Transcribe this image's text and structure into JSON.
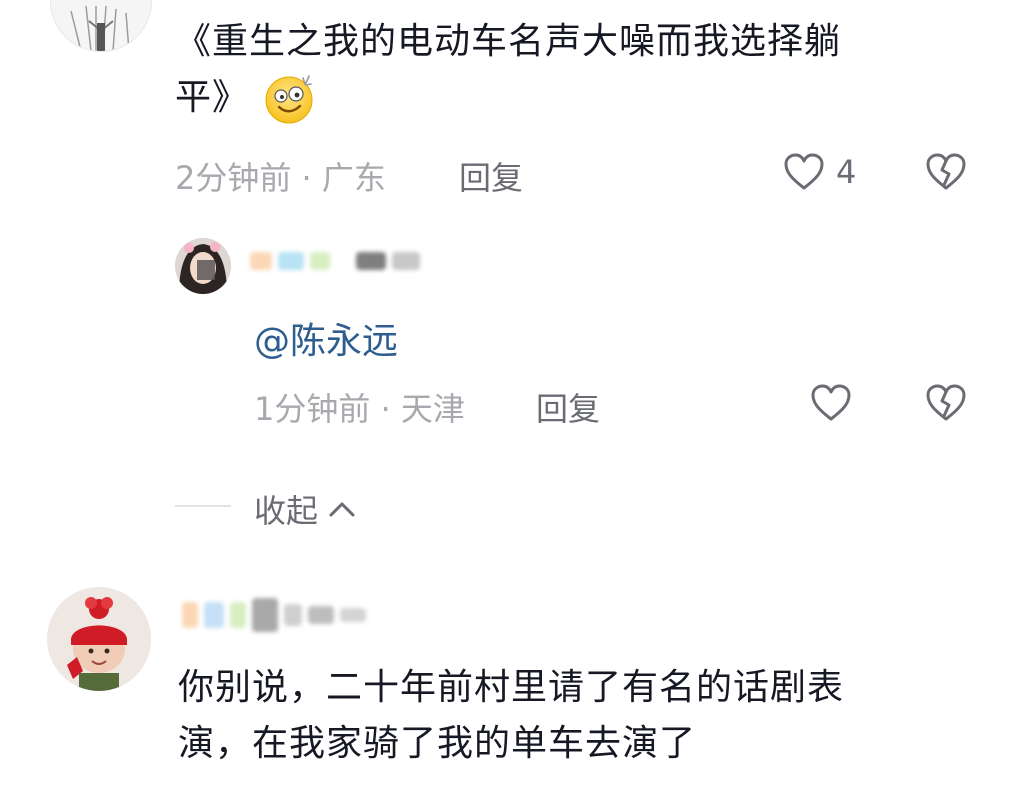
{
  "comment_1": {
    "text_line_1": "《重生之我的电动车名声大噪而我选择躺",
    "text_line_2": "平》",
    "emoji": "dizzy-grin-emoji",
    "time_location": "2分钟前 · 广东",
    "reply_label": "回复",
    "like_count": "4"
  },
  "reply_1": {
    "text": "@陈永远",
    "time_location": "1分钟前 · 天津",
    "reply_label": "回复"
  },
  "collapse": {
    "label": "收起"
  },
  "comment_2": {
    "text_line_1": "你别说，二十年前村里请了有名的话剧表",
    "text_line_2": "演，在我家骑了我的单车去演了"
  },
  "colors": {
    "text": "#161823",
    "meta": "#a7a9ae",
    "mention": "#2d5e8f",
    "icon": "#6a6c73"
  },
  "icons": {
    "like": "heart-outline-icon",
    "dislike": "broken-heart-icon",
    "collapse": "chevron-up-icon"
  }
}
